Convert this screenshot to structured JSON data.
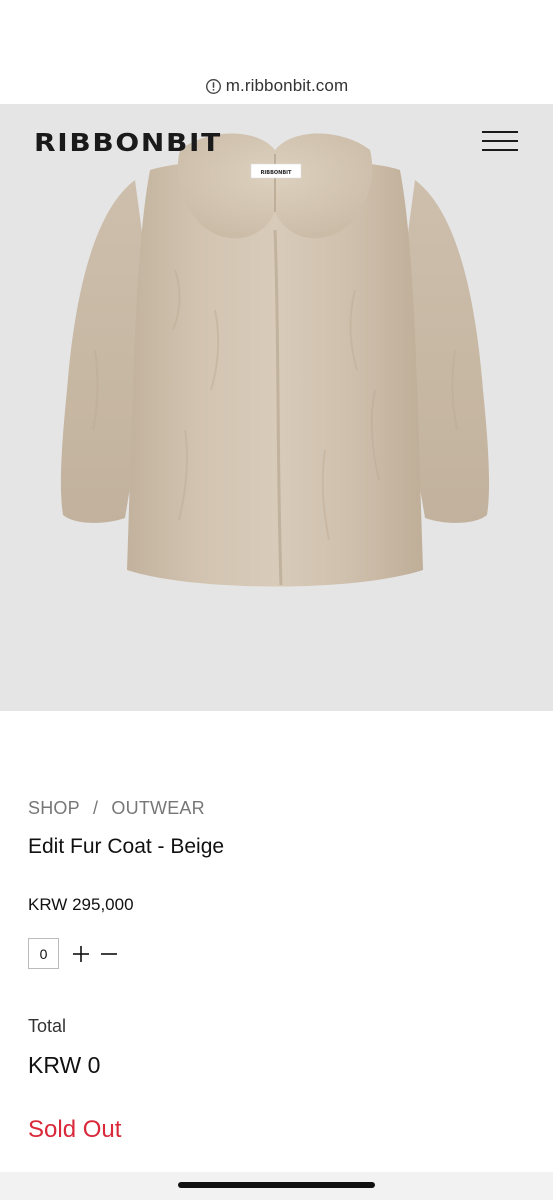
{
  "browser": {
    "url": "m.ribbonbit.com",
    "info_icon": "info-circle-icon"
  },
  "header": {
    "logo": "RIBBONBIT",
    "menu_icon": "hamburger-menu-icon"
  },
  "product": {
    "image": "beige-fur-coat-image",
    "label_tag": "RIBBONBIT",
    "breadcrumb": {
      "shop": "SHOP",
      "separator": "/",
      "category": "OUTWEAR"
    },
    "title": "Edit Fur Coat - Beige",
    "price": "KRW 295,000",
    "quantity": "0",
    "plus_icon": "plus-icon",
    "minus_icon": "minus-icon"
  },
  "summary": {
    "total_label": "Total",
    "total_value": "KRW 0",
    "status": "Sold Out"
  },
  "colors": {
    "hero_bg": "#e5e5e5",
    "coat": "#cbbca8",
    "sold_out": "#d9283a"
  }
}
